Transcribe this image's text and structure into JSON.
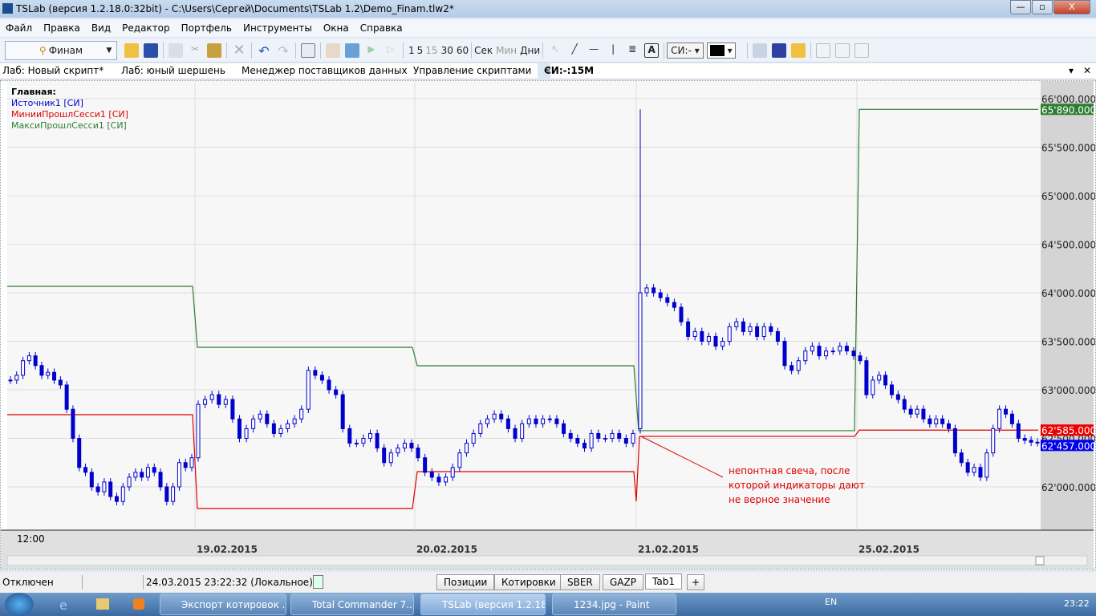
{
  "window": {
    "title": "TSLab (версия 1.2.18.0:32bit) - C:\\Users\\Сергей\\Documents\\TSLab 1.2\\Demo_Finam.tlw2*",
    "min": "—",
    "max": "▫",
    "close": "X"
  },
  "menu": [
    "Файл",
    "Правка",
    "Вид",
    "Редактор",
    "Портфель",
    "Инструменты",
    "Окна",
    "Справка"
  ],
  "toolbar": {
    "provider": "Финам",
    "intervals": [
      "1",
      "5",
      "15",
      "30",
      "60"
    ],
    "units": [
      "Сек",
      "Мин",
      "Дни"
    ],
    "symbol": "СИ:-",
    "color": "#000000"
  },
  "tabs": [
    "Лаб: Новый скрипт*",
    "Лаб: юный шершень",
    "Менеджер поставщиков данных",
    "Управление скриптами",
    "СИ:-:15М"
  ],
  "chart_data": {
    "type": "candlestick",
    "legend_title": "Главная:",
    "legend": [
      {
        "name": "Источник1 [СИ]",
        "color": "#0000cc"
      },
      {
        "name": "МинииПрошлСесси1 [СИ]",
        "color": "#dd0000"
      },
      {
        "name": "МаксиПрошлСесси1 [СИ]",
        "color": "#2e7d32"
      }
    ],
    "ylim": [
      61500,
      66100
    ],
    "yticks": [
      62000,
      62500,
      63000,
      63500,
      64000,
      64500,
      65000,
      65500,
      66000
    ],
    "ytick_labels": [
      "62'000.000",
      "62'500.000",
      "63'000.000",
      "63'500.000",
      "64'000.000",
      "64'500.000",
      "65'000.000",
      "65'500.000",
      "66'000.000"
    ],
    "time_label": "12:00",
    "sessions": [
      "",
      "19.02.2015",
      "20.02.2015",
      "21.02.2015",
      "25.02.2015"
    ],
    "closes": [
      [
        63100,
        63150,
        63300,
        63350,
        63250,
        63150,
        63180,
        63100,
        63050,
        62800,
        62500,
        62200,
        62150,
        62000,
        61950,
        62050,
        61900,
        61850,
        62000,
        62100,
        62150,
        62100,
        62200,
        62150,
        62000,
        61850,
        62000,
        62250,
        62200,
        62300
      ],
      [
        62850,
        62900,
        62950,
        62850,
        62900,
        62700,
        62500,
        62600,
        62700,
        62750,
        62650,
        62550,
        62600,
        62650,
        62700,
        62800,
        63200,
        63150,
        63100,
        63000,
        62950,
        62600,
        62450,
        62450,
        62500,
        62550,
        62400,
        62250,
        62350,
        62400,
        62450,
        62400
      ],
      [
        62300,
        62150,
        62100,
        62050,
        62100,
        62200,
        62350,
        62450,
        62550,
        62650,
        62700,
        62750,
        62700,
        62600,
        62500,
        62650,
        62700,
        62650,
        62700,
        62700,
        62650,
        62550,
        62500,
        62450,
        62400,
        62550,
        62500,
        62500,
        62550,
        62500,
        62450,
        62550
      ],
      [
        64050,
        64000,
        63950,
        63900,
        63850,
        63700,
        63550,
        63600,
        63500,
        63550,
        63450,
        63500,
        63650,
        63700,
        63600,
        63650,
        63550,
        63650,
        63600,
        63500,
        63250,
        63200,
        63300,
        63400,
        63450,
        63350,
        63400,
        63400,
        63450,
        63400,
        63350
      ],
      [
        63300,
        62950,
        63100,
        63150,
        63050,
        62950,
        62900,
        62800,
        62750,
        62800,
        62700,
        62650,
        62700,
        62650,
        62600,
        62350,
        62250,
        62150,
        62200,
        62100,
        62350,
        62600,
        62800,
        62750,
        62650,
        62500,
        62480,
        62460,
        62457
      ]
    ],
    "spike_candle": {
      "o": 62600,
      "h": 65890,
      "l": 62550,
      "c": 64000
    },
    "max_prev_session": [
      64066,
      63438,
      63248,
      62579,
      65890
    ],
    "min_prev_session": [
      62744,
      61777,
      62157,
      62520,
      62585
    ],
    "min_dip": 61850,
    "last_labels": {
      "max": "65'890.000",
      "min": "62'585.000",
      "close": "62'457.000"
    },
    "annotation": [
      "непонтная свеча, после",
      "которой индикаторы дают",
      "не верное значение"
    ]
  },
  "status": {
    "connection": "Отключен",
    "time": "24.03.2015 23:22:32 (Локальное)",
    "tabs": [
      "Позиции",
      "Котировки",
      "SBER",
      "GAZP",
      "Tab1",
      "+"
    ]
  },
  "taskbar": {
    "items": [
      "Экспорт котировок ...",
      "Total Commander 7....",
      "TSLab (версия 1.2.18...",
      "1234.jpg - Paint"
    ],
    "lang": "EN",
    "clock": "23:22"
  }
}
